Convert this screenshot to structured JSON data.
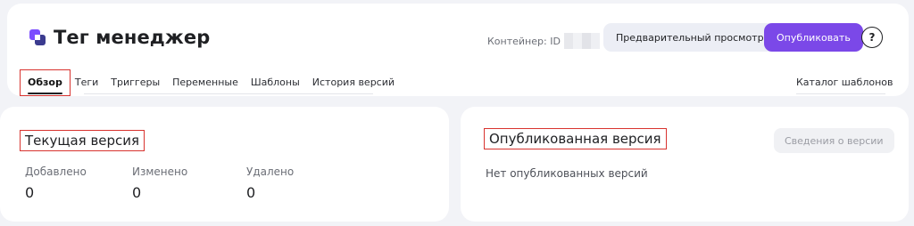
{
  "header": {
    "title": "Тег менеджер",
    "container_label": "Контейнер: ID",
    "preview_button": "Предварительный просмотр",
    "publish_button": "Опубликовать",
    "help_button": "?",
    "tabs": [
      {
        "label": "Обзор",
        "active": true
      },
      {
        "label": "Теги"
      },
      {
        "label": "Триггеры"
      },
      {
        "label": "Переменные"
      },
      {
        "label": "Шаблоны"
      },
      {
        "label": "История версий"
      }
    ],
    "catalog_link": "Каталог шаблонов"
  },
  "current_version": {
    "title": "Текущая версия",
    "stats": [
      {
        "label": "Добавлено",
        "value": "0"
      },
      {
        "label": "Изменено",
        "value": "0"
      },
      {
        "label": "Удалено",
        "value": "0"
      }
    ]
  },
  "published_version": {
    "title": "Опубликованная версия",
    "info_button": "Сведения о версии",
    "empty_text": "Нет опубликованных версий"
  },
  "colors": {
    "accent": "#7b48e8",
    "highlight_box": "#d8332f",
    "background": "#f2f3f7"
  }
}
